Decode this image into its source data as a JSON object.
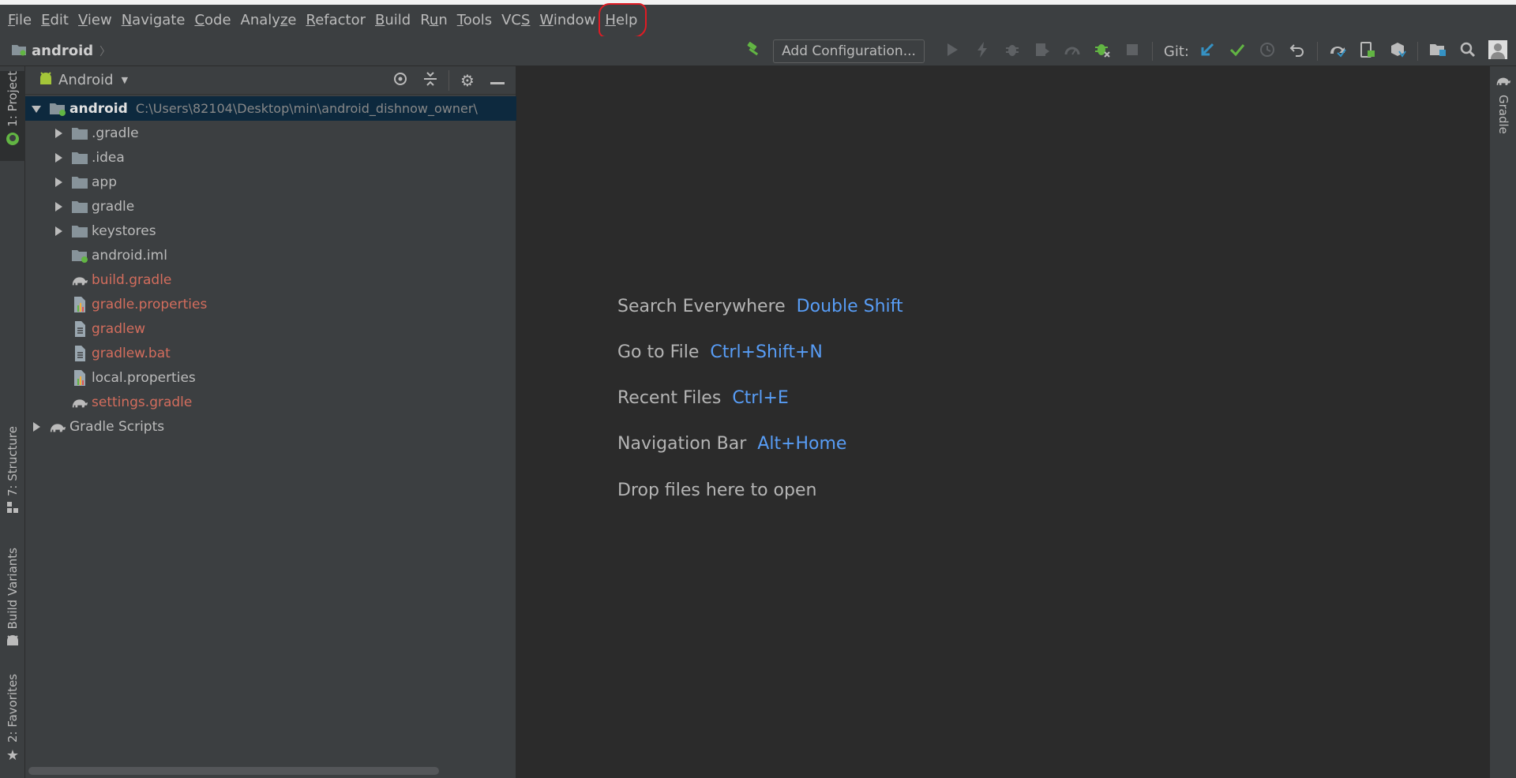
{
  "menu": {
    "items": [
      {
        "pre": "",
        "mn": "F",
        "post": "ile"
      },
      {
        "pre": "",
        "mn": "E",
        "post": "dit"
      },
      {
        "pre": "",
        "mn": "V",
        "post": "iew"
      },
      {
        "pre": "",
        "mn": "N",
        "post": "avigate"
      },
      {
        "pre": "",
        "mn": "C",
        "post": "ode"
      },
      {
        "pre": "Analy",
        "mn": "z",
        "post": "e"
      },
      {
        "pre": "",
        "mn": "R",
        "post": "efactor"
      },
      {
        "pre": "",
        "mn": "B",
        "post": "uild"
      },
      {
        "pre": "R",
        "mn": "u",
        "post": "n"
      },
      {
        "pre": "",
        "mn": "T",
        "post": "ools"
      },
      {
        "pre": "VC",
        "mn": "S",
        "post": ""
      },
      {
        "pre": "",
        "mn": "W",
        "post": "indow"
      },
      {
        "pre": "",
        "mn": "H",
        "post": "elp"
      }
    ]
  },
  "navbar": {
    "breadcrumb": "android",
    "add_config_label": "Add Configuration...",
    "git_label": "Git:"
  },
  "left_stripe": {
    "project_tab": "1: Project",
    "structure_tab": "7: Structure",
    "build_variants_tab": "Build Variants",
    "favorites_tab": "2: Favorites"
  },
  "right_stripe": {
    "gradle_tab": "Gradle"
  },
  "project_panel": {
    "view_mode": "Android",
    "tree": [
      {
        "name": "android",
        "path": "C:\\Users\\82104\\Desktop\\min\\android_dishnow_owner\\",
        "type": "module",
        "level": 0,
        "expanded": true,
        "style": "bold",
        "selected": true
      },
      {
        "name": ".gradle",
        "type": "folder",
        "level": 1,
        "expanded": false,
        "style": "normal"
      },
      {
        "name": ".idea",
        "type": "folder",
        "level": 1,
        "expanded": false,
        "style": "normal"
      },
      {
        "name": "app",
        "type": "folder",
        "level": 1,
        "expanded": false,
        "style": "normal"
      },
      {
        "name": "gradle",
        "type": "folder",
        "level": 1,
        "expanded": false,
        "style": "normal"
      },
      {
        "name": "keystores",
        "type": "folder",
        "level": 1,
        "expanded": false,
        "style": "normal"
      },
      {
        "name": "android.iml",
        "type": "iml",
        "level": 1,
        "style": "normal"
      },
      {
        "name": "build.gradle",
        "type": "gradle",
        "level": 1,
        "style": "red"
      },
      {
        "name": "gradle.properties",
        "type": "properties",
        "level": 1,
        "style": "red"
      },
      {
        "name": "gradlew",
        "type": "text",
        "level": 1,
        "style": "red"
      },
      {
        "name": "gradlew.bat",
        "type": "text",
        "level": 1,
        "style": "red"
      },
      {
        "name": "local.properties",
        "type": "properties",
        "level": 1,
        "style": "normal"
      },
      {
        "name": "settings.gradle",
        "type": "gradle",
        "level": 1,
        "style": "red"
      },
      {
        "name": "Gradle Scripts",
        "type": "gradle",
        "level": 0,
        "expanded": false,
        "style": "normal"
      }
    ]
  },
  "editor": {
    "hints": [
      {
        "label": "Search Everywhere",
        "shortcut": "Double Shift"
      },
      {
        "label": "Go to File",
        "shortcut": "Ctrl+Shift+N"
      },
      {
        "label": "Recent Files",
        "shortcut": "Ctrl+E"
      },
      {
        "label": "Navigation Bar",
        "shortcut": "Alt+Home"
      },
      {
        "label": "Drop files here to open",
        "shortcut": ""
      }
    ]
  },
  "colors": {
    "background": "#3c3f41",
    "editor_bg": "#2b2b2b",
    "selection": "#0d293e",
    "shortcut_blue": "#589df6",
    "modified_red": "#d36d5d",
    "highlight_circle": "#e01b24"
  }
}
